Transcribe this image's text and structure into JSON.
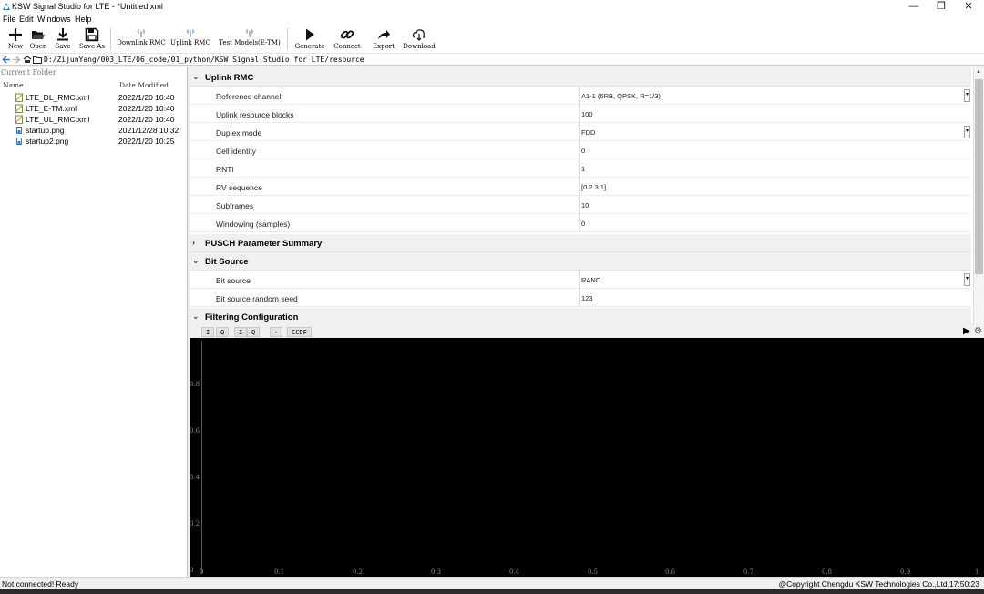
{
  "window": {
    "title": "KSW Signal Studio for LTE  - *Untitled.xml",
    "minimize_glyph": "—",
    "restore_glyph": "❐",
    "close_glyph": "✕"
  },
  "menu": [
    "File",
    "Edit",
    "Windows",
    "Help"
  ],
  "toolbar": {
    "new": "New",
    "open": "Open",
    "save": "Save",
    "save_as": "Save As",
    "downlink_rmc": "Downlink RMC",
    "uplink_rmc": "Uplink RMC",
    "test_models": "Test Models(E-TM)",
    "generate": "Generate",
    "connect": "Connect",
    "export": "Export",
    "download": "Download"
  },
  "path": "D:/ZijunYang/003_LTE/06_code/01_python/KSW Signal Studio for LTE/resource",
  "file_panel": {
    "header": "Current Folder",
    "col_name": "Name",
    "col_date": "Date Modified",
    "files": [
      {
        "name": "LTE_DL_RMC.xml",
        "date": "2022/1/20 10:40",
        "icon": "xml-file-icon"
      },
      {
        "name": "LTE_E-TM.xml",
        "date": "2022/1/20 10:40",
        "icon": "xml-file-icon"
      },
      {
        "name": "LTE_UL_RMC.xml",
        "date": "2022/1/20 10:40",
        "icon": "xml-file-icon"
      },
      {
        "name": "startup.png",
        "date": "2021/12/28 10:32",
        "icon": "image-file-icon"
      },
      {
        "name": "startup2.png",
        "date": "2022/1/20 10:25",
        "icon": "image-file-icon"
      }
    ]
  },
  "property_grid": {
    "groups": [
      {
        "label": "Uplink RMC",
        "expanded": true,
        "rows": [
          {
            "name": "Reference channel",
            "value": "A1-1 (6RB, QPSK, R=1/3)",
            "dropdown": true
          },
          {
            "name": "Uplink resource blocks",
            "value": "100",
            "dropdown": false
          },
          {
            "name": "Duplex mode",
            "value": "FDD",
            "dropdown": true
          },
          {
            "name": "Cell identity",
            "value": "0",
            "dropdown": false
          },
          {
            "name": "RNTI",
            "value": "1",
            "dropdown": false
          },
          {
            "name": "RV sequence",
            "value": "[0 2 3 1]",
            "dropdown": false
          },
          {
            "name": "Subframes",
            "value": "10",
            "dropdown": false
          },
          {
            "name": "Windowing (samples)",
            "value": "0",
            "dropdown": false
          }
        ]
      },
      {
        "label": "PUSCH Parameter Summary",
        "expanded": false,
        "rows": []
      },
      {
        "label": "Bit Source",
        "expanded": true,
        "rows": [
          {
            "name": "Bit source",
            "value": "RAND",
            "dropdown": true
          },
          {
            "name": "Bit source random seed",
            "value": "123",
            "dropdown": false
          }
        ]
      },
      {
        "label": "Filtering Configuration",
        "expanded": true,
        "rows": []
      }
    ]
  },
  "plot": {
    "tabs": [
      "I",
      "Q",
      "I",
      "Q",
      "·",
      "CCDF"
    ],
    "y_ticks": [
      "0.8",
      "0.6",
      "0.4",
      "0.2",
      "0"
    ],
    "x_ticks": [
      "0",
      "0.1",
      "0.2",
      "0.3",
      "0.4",
      "0.5",
      "0.6",
      "0.7",
      "0.8",
      "0.9",
      "1"
    ],
    "play_glyph": "▶",
    "settings_glyph": "⚙"
  },
  "status": {
    "text": "Not connected! Ready",
    "copyright": "@Copyright Chengdu KSW Technologies Co.,Ltd.",
    "time": "17:50:23"
  },
  "colors": {
    "plot_background": "#000000",
    "accent": "#1a6fd6",
    "panel_background": "#f0f0f0"
  }
}
